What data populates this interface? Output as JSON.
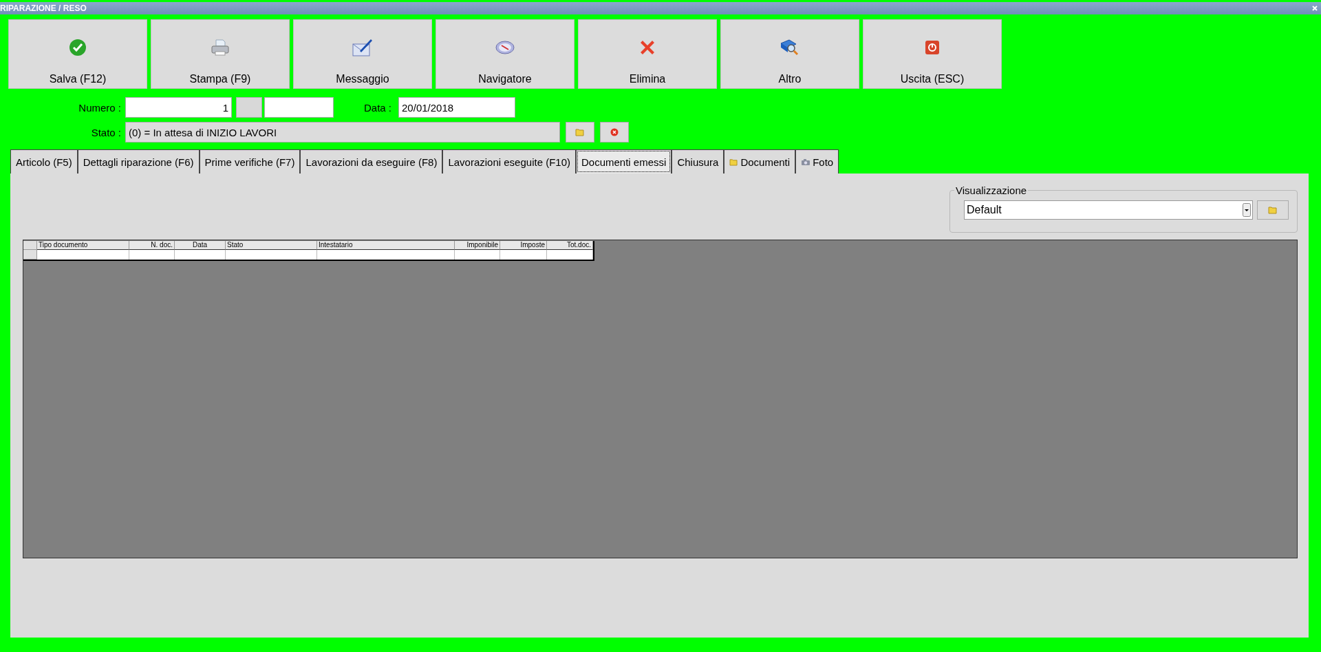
{
  "window": {
    "title": "RIPARAZIONE / RESO"
  },
  "toolbar": [
    {
      "label": "Salva (F12)",
      "kind": "save"
    },
    {
      "label": "Stampa (F9)",
      "kind": "print"
    },
    {
      "label": "Messaggio",
      "kind": "message"
    },
    {
      "label": "Navigatore",
      "kind": "compass"
    },
    {
      "label": "Elimina",
      "kind": "delete"
    },
    {
      "label": "Altro",
      "kind": "search"
    },
    {
      "label": "Uscita (ESC)",
      "kind": "exit"
    }
  ],
  "form": {
    "numero_label": "Numero :",
    "numero": "1",
    "data_label": "Data :",
    "data": "20/01/2018",
    "stato_label": "Stato :",
    "stato": "(0) = In attesa di INIZIO LAVORI"
  },
  "tabs": [
    {
      "label": "Articolo (F5)",
      "selected": false
    },
    {
      "label": "Dettagli riparazione (F6)",
      "selected": false
    },
    {
      "label": "Prime verifiche (F7)",
      "selected": false
    },
    {
      "label": "Lavorazioni da eseguire (F8)",
      "selected": false
    },
    {
      "label": "Lavorazioni eseguite  (F10)",
      "selected": false
    },
    {
      "label": "Documenti emessi",
      "selected": true
    },
    {
      "label": "Chiusura",
      "selected": false
    },
    {
      "label": "Documenti",
      "selected": false,
      "kind": "folder"
    },
    {
      "label": "Foto",
      "selected": false,
      "kind": "camera"
    }
  ],
  "view": {
    "legend": "Visualizzazione",
    "value": "Default"
  },
  "table": {
    "columns": [
      "Tipo documento",
      "N. doc.",
      "Data",
      "Stato",
      "Intestatario",
      "Imponibile",
      "Imposte",
      "Tot.doc."
    ]
  }
}
